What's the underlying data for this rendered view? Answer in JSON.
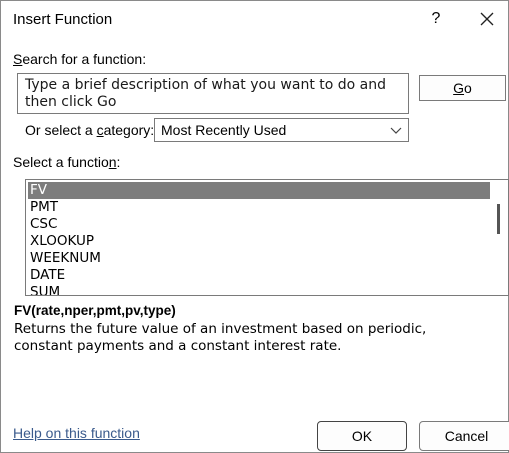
{
  "window": {
    "title": "Insert Function",
    "help_glyph": "?"
  },
  "search": {
    "label_prefix": "",
    "label_accel": "S",
    "label_rest": "earch for a function:",
    "value": "Type a brief description of what you want to do and then click Go",
    "go_accel": "G",
    "go_rest": "o"
  },
  "category": {
    "label_pre": "Or select a ",
    "label_accel": "c",
    "label_rest": "ategory:",
    "selected": "Most Recently Used"
  },
  "functions": {
    "label_pre": "Select a functio",
    "label_accel": "n",
    "label_post": ":",
    "items": [
      "FV",
      "PMT",
      "CSC",
      "XLOOKUP",
      "WEEKNUM",
      "DATE",
      "SUM"
    ],
    "selected_index": 0
  },
  "details": {
    "signature": "FV(rate,nper,pmt,pv,type)",
    "description": "Returns the future value of an investment based on periodic, constant payments and a constant interest rate."
  },
  "footer": {
    "help_link": "Help on this function",
    "ok": "OK",
    "cancel": "Cancel"
  },
  "colors": {
    "selection": "#7d7d7d",
    "link": "#3a5a8c"
  }
}
